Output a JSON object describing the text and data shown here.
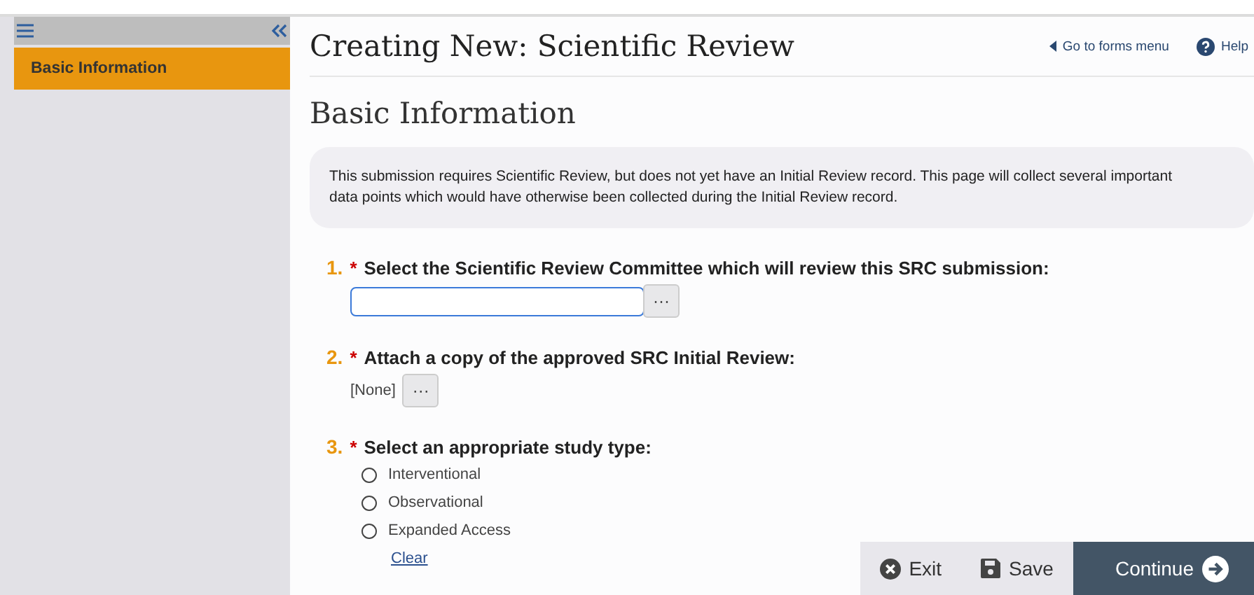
{
  "sidebar": {
    "items": [
      {
        "label": "Basic Information",
        "selected": true
      }
    ]
  },
  "header": {
    "title": "Creating New: Scientific Review",
    "links": [
      {
        "kind": "back",
        "label": "Go to forms menu"
      },
      {
        "kind": "help",
        "label": "Help"
      }
    ]
  },
  "section_title": "Basic Information",
  "notice": "This submission requires Scientific Review, but does not yet have an Initial Review record.  This page will collect several important data points which would have otherwise been collected during the Initial Review record.",
  "questions": [
    {
      "number": "1.",
      "required_mark": "*",
      "kind": "lookup",
      "label": "Select the Scientific Review Committee which will review this SRC submission:",
      "button": "···"
    },
    {
      "number": "2.",
      "required_mark": "*",
      "kind": "attach",
      "label": "Attach a copy of the approved SRC Initial Review:",
      "value": "[None]",
      "button": "···"
    },
    {
      "number": "3.",
      "required_mark": "*",
      "kind": "radio",
      "label": "Select an appropriate study type:",
      "options": [
        {
          "label": "Interventional",
          "selected": false
        },
        {
          "label": "Observational",
          "selected": false
        },
        {
          "label": "Expanded Access",
          "selected": false
        }
      ],
      "clear": "Clear"
    }
  ],
  "footer": {
    "buttons": [
      {
        "kind": "exit",
        "label": "Exit"
      },
      {
        "kind": "save",
        "label": "Save"
      },
      {
        "kind": "continue",
        "label": "Continue"
      }
    ]
  }
}
